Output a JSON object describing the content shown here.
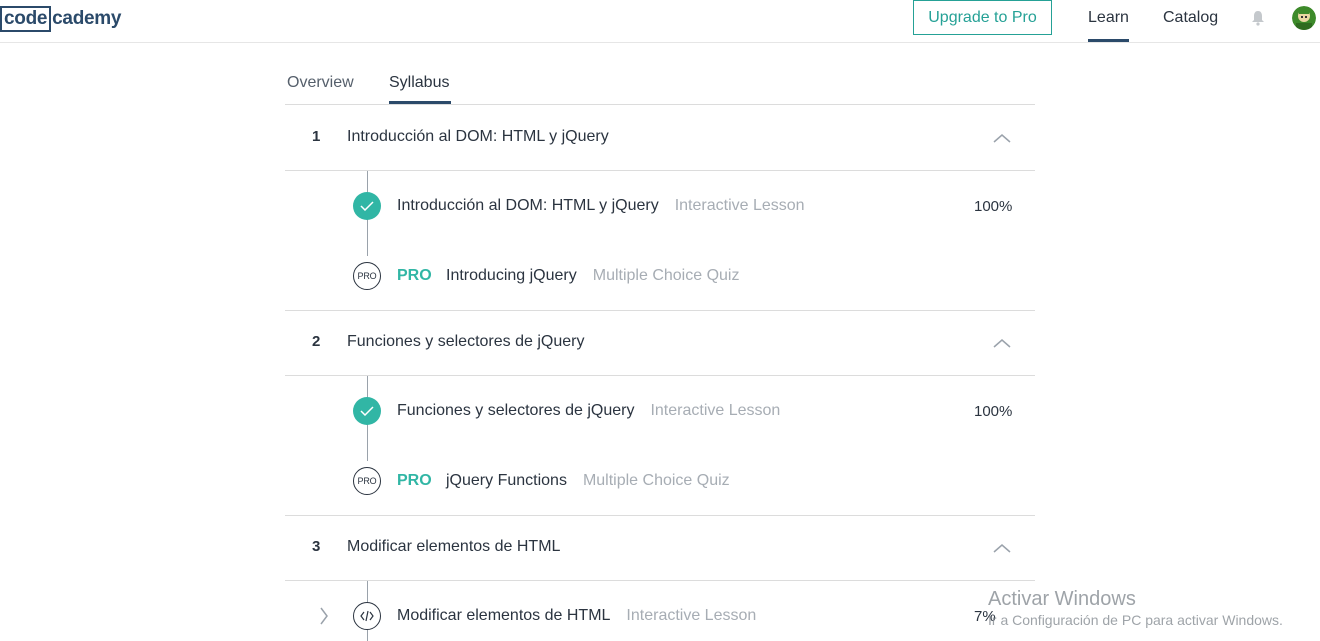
{
  "header": {
    "logo_code": "code",
    "logo_cademy": "cademy",
    "upgrade_label": "Upgrade to Pro",
    "nav_learn": "Learn",
    "nav_catalog": "Catalog"
  },
  "tabs": {
    "overview": "Overview",
    "syllabus": "Syllabus",
    "active": "Syllabus"
  },
  "sections": [
    {
      "num": "1",
      "title": "Introducción al DOM: HTML y jQuery",
      "lessons": [
        {
          "status": "complete",
          "title": "Introducción al DOM: HTML y jQuery",
          "type": "Interactive Lesson",
          "progress": "100%"
        },
        {
          "status": "pro",
          "badge": "PRO",
          "icon_label": "PRO",
          "title": "Introducing jQuery",
          "type": "Multiple Choice Quiz"
        }
      ]
    },
    {
      "num": "2",
      "title": "Funciones y selectores de jQuery",
      "lessons": [
        {
          "status": "complete",
          "title": "Funciones y selectores de jQuery",
          "type": "Interactive Lesson",
          "progress": "100%"
        },
        {
          "status": "pro",
          "badge": "PRO",
          "icon_label": "PRO",
          "title": "jQuery Functions",
          "type": "Multiple Choice Quiz"
        }
      ]
    },
    {
      "num": "3",
      "title": "Modificar elementos de HTML",
      "lessons": [
        {
          "status": "in-progress",
          "title": "Modificar elementos de HTML",
          "type": "Interactive Lesson",
          "progress": "7%"
        }
      ]
    }
  ],
  "watermark": {
    "line1": "Activar Windows",
    "line2": "Ir a Configuración de PC para activar Windows."
  },
  "colors": {
    "accent": "#31b6a5",
    "brand": "#2b4a6a",
    "text": "#2b3440",
    "muted": "#a7adb4"
  }
}
